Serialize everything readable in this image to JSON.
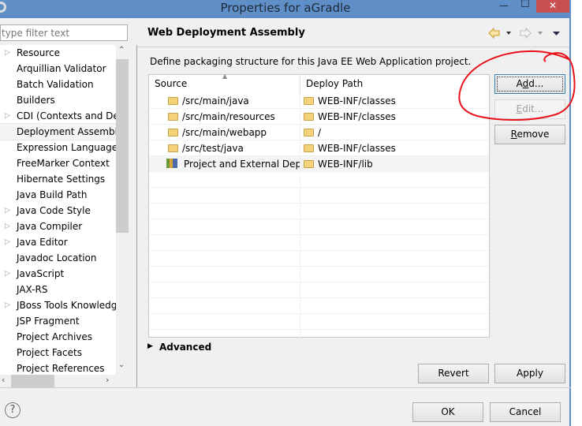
{
  "window": {
    "title": "Properties for aGradle",
    "close": "✕",
    "minimize": "—",
    "maximize": "☐"
  },
  "sidebar": {
    "filter_placeholder": "type filter text",
    "items": [
      {
        "label": "Resource",
        "expandable": true
      },
      {
        "label": "Arquillian Validator",
        "expandable": false
      },
      {
        "label": "Batch Validation",
        "expandable": false
      },
      {
        "label": "Builders",
        "expandable": false
      },
      {
        "label": "CDI (Contexts and De",
        "expandable": true
      },
      {
        "label": "Deployment Assembly",
        "expandable": false,
        "selected": true
      },
      {
        "label": "Expression Language",
        "expandable": false
      },
      {
        "label": "FreeMarker Context",
        "expandable": false
      },
      {
        "label": "Hibernate Settings",
        "expandable": false
      },
      {
        "label": "Java Build Path",
        "expandable": false
      },
      {
        "label": "Java Code Style",
        "expandable": true
      },
      {
        "label": "Java Compiler",
        "expandable": true
      },
      {
        "label": "Java Editor",
        "expandable": true
      },
      {
        "label": "Javadoc Location",
        "expandable": false
      },
      {
        "label": "JavaScript",
        "expandable": true
      },
      {
        "label": "JAX-RS",
        "expandable": false
      },
      {
        "label": "JBoss Tools Knowledg",
        "expandable": true
      },
      {
        "label": "JSP Fragment",
        "expandable": false
      },
      {
        "label": "Project Archives",
        "expandable": false
      },
      {
        "label": "Project Facets",
        "expandable": false
      },
      {
        "label": "Project References",
        "expandable": false
      }
    ]
  },
  "page": {
    "title": "Web Deployment Assembly",
    "description": "Define packaging structure for this Java EE Web Application project.",
    "columns": [
      "Source",
      "Deploy Path"
    ],
    "rows": [
      {
        "source": "/src/main/java",
        "deploy": "WEB-INF/classes",
        "icon": "folder"
      },
      {
        "source": "/src/main/resources",
        "deploy": "WEB-INF/classes",
        "icon": "folder"
      },
      {
        "source": "/src/main/webapp",
        "deploy": "/",
        "icon": "folder"
      },
      {
        "source": "/src/test/java",
        "deploy": "WEB-INF/classes",
        "icon": "folder"
      },
      {
        "source": "Project and External Depe",
        "deploy": "WEB-INF/lib",
        "icon": "library"
      }
    ],
    "buttons": {
      "add": "Add...",
      "edit": "Edit...",
      "remove": "Remove"
    },
    "advanced": "Advanced",
    "revert": "Revert",
    "apply": "Apply"
  },
  "footer": {
    "ok": "OK",
    "cancel": "Cancel",
    "help": "?"
  },
  "annotation_color": "#e8121a"
}
